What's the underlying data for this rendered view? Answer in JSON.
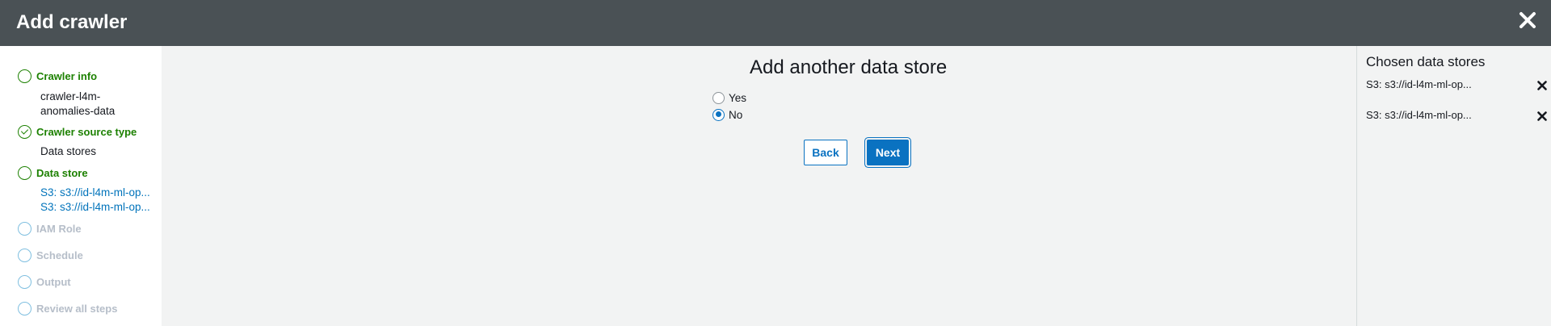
{
  "header": {
    "title": "Add crawler",
    "close_icon": "close-icon"
  },
  "sidebar": {
    "steps": [
      {
        "label": "Crawler info",
        "state": "current",
        "sub": [
          "crawler-l4m-",
          "anomalies-data"
        ]
      },
      {
        "label": "Crawler source type",
        "state": "done",
        "sub": [
          "Data stores"
        ]
      },
      {
        "label": "Data store",
        "state": "current",
        "links": [
          "S3: s3://id-l4m-ml-op...",
          "S3: s3://id-l4m-ml-op..."
        ]
      },
      {
        "label": "IAM Role",
        "state": "inactive"
      },
      {
        "label": "Schedule",
        "state": "inactive"
      },
      {
        "label": "Output",
        "state": "inactive"
      },
      {
        "label": "Review all steps",
        "state": "inactive"
      }
    ]
  },
  "main": {
    "title": "Add another data store",
    "options": [
      {
        "label": "Yes",
        "checked": false
      },
      {
        "label": "No",
        "checked": true
      }
    ],
    "back_label": "Back",
    "next_label": "Next"
  },
  "chosen": {
    "title": "Chosen data stores",
    "items": [
      "S3: s3://id-l4m-ml-op...",
      "S3: s3://id-l4m-ml-op..."
    ]
  },
  "colors": {
    "header_bg": "#4a5155",
    "accent": "#0a72c1",
    "success": "#1d8102",
    "link": "#0073bb"
  }
}
